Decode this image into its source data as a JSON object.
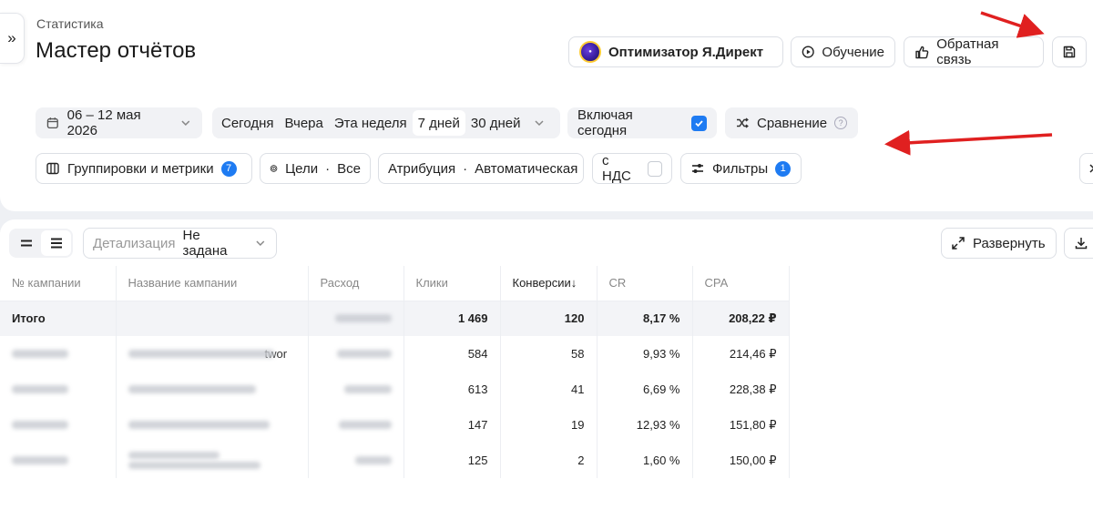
{
  "header": {
    "breadcrumb": "Статистика",
    "title": "Мастер отчётов",
    "collapse_icon": "»",
    "optimizer_label": "Оптимизатор Я.Директ",
    "learn_label": "Обучение",
    "feedback_label": "Обратная связь"
  },
  "filters_row1": {
    "date_range": "06 – 12 мая 2026",
    "periods": [
      "Сегодня",
      "Вчера",
      "Эта неделя",
      "7 дней",
      "30 дней"
    ],
    "active_period": "7 дней",
    "include_today_label": "Включая сегодня",
    "include_today_checked": true,
    "compare_label": "Сравнение"
  },
  "filters_row2": {
    "grouping_label": "Группировки и метрики",
    "grouping_count": "7",
    "goals_label": "Цели",
    "goals_value": "Все",
    "attribution_label": "Атрибуция",
    "attribution_value": "Автоматическая",
    "nds_label": "с НДС",
    "nds_checked": false,
    "filters_label": "Фильтры",
    "filters_count": "1"
  },
  "toolbar": {
    "detail_label": "Детализация",
    "detail_value": "Не задана",
    "expand_label": "Развернуть"
  },
  "table": {
    "columns": [
      "№ кампании",
      "Название кампании",
      "Расход",
      "Клики",
      "Конверсии↓",
      "CR",
      "CPA"
    ],
    "total": {
      "label": "Итого",
      "clicks": "1 469",
      "conversions": "120",
      "cr": "8,17 %",
      "cpa": "208,22 ₽"
    },
    "rows": [
      {
        "name_tail": "twor",
        "clicks": "584",
        "conversions": "58",
        "cr": "9,93 %",
        "cpa": "214,46 ₽"
      },
      {
        "name_tail": "",
        "clicks": "613",
        "conversions": "41",
        "cr": "6,69 %",
        "cpa": "228,38 ₽"
      },
      {
        "name_tail": "",
        "clicks": "147",
        "conversions": "19",
        "cr": "12,93 %",
        "cpa": "151,80 ₽"
      },
      {
        "name_tail": "",
        "clicks": "125",
        "conversions": "2",
        "cr": "1,60 %",
        "cpa": "150,00 ₽"
      }
    ]
  },
  "colors": {
    "accent": "#1e7bf2",
    "arrow": "#e02020",
    "chip_bg": "#f1f2f5"
  },
  "icons": [
    "calendar-icon",
    "chevron-down-icon",
    "shuffle-icon",
    "help-icon",
    "columns-icon",
    "target-icon",
    "sliders-icon",
    "play-icon",
    "thumbs-up-icon",
    "save-icon",
    "expand-icon",
    "download-icon",
    "list-compact-icon",
    "list-icon"
  ]
}
